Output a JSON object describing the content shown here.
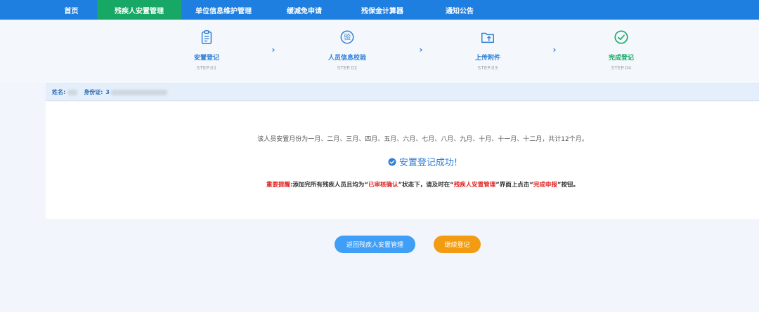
{
  "nav": {
    "items": [
      {
        "label": "首页"
      },
      {
        "label": "残疾人安置管理"
      },
      {
        "label": "单位信息维护管理"
      },
      {
        "label": "缓减免申请"
      },
      {
        "label": "残保金计算器"
      },
      {
        "label": "通知公告"
      }
    ],
    "active_index": 1
  },
  "steps": [
    {
      "label": "安置登记",
      "sub": "STEP.01",
      "icon": "clipboard-icon"
    },
    {
      "label": "人员信息校验",
      "sub": "STEP.02",
      "icon": "verify-icon"
    },
    {
      "label": "上传附件",
      "sub": "STEP.03",
      "icon": "upload-folder-icon"
    },
    {
      "label": "完成登记",
      "sub": "STEP.04",
      "icon": "check-circle-icon"
    }
  ],
  "step_arrow": "›",
  "info": {
    "name_label": "姓名:",
    "id_label": "身份证:",
    "id_prefix": "3"
  },
  "result": {
    "months_text": "该人员安置月份为一月、二月、三月、四月、五月、六月、七月、八月、九月、十月、十一月、十二月，共计12个月。",
    "success_text": "安置登记成功!",
    "notice": {
      "prefix": "重要提醒:",
      "part1": "添加完所有残疾人员且均为“",
      "status": "已审核确认",
      "part2": "”状态下，请及时在“",
      "page": "残疾人安置管理",
      "part3": "”界面上点击“",
      "action": "完成申报",
      "part4": "”按钮。"
    }
  },
  "buttons": {
    "return_label": "返回残疾人安置管理",
    "continue_label": "继续登记"
  },
  "colors": {
    "nav_bg": "#1f7fe0",
    "nav_active": "#18a865",
    "accent": "#2f7fd6",
    "done": "#18a865",
    "warning": "#e02020",
    "continue_btn": "#f39c12"
  }
}
